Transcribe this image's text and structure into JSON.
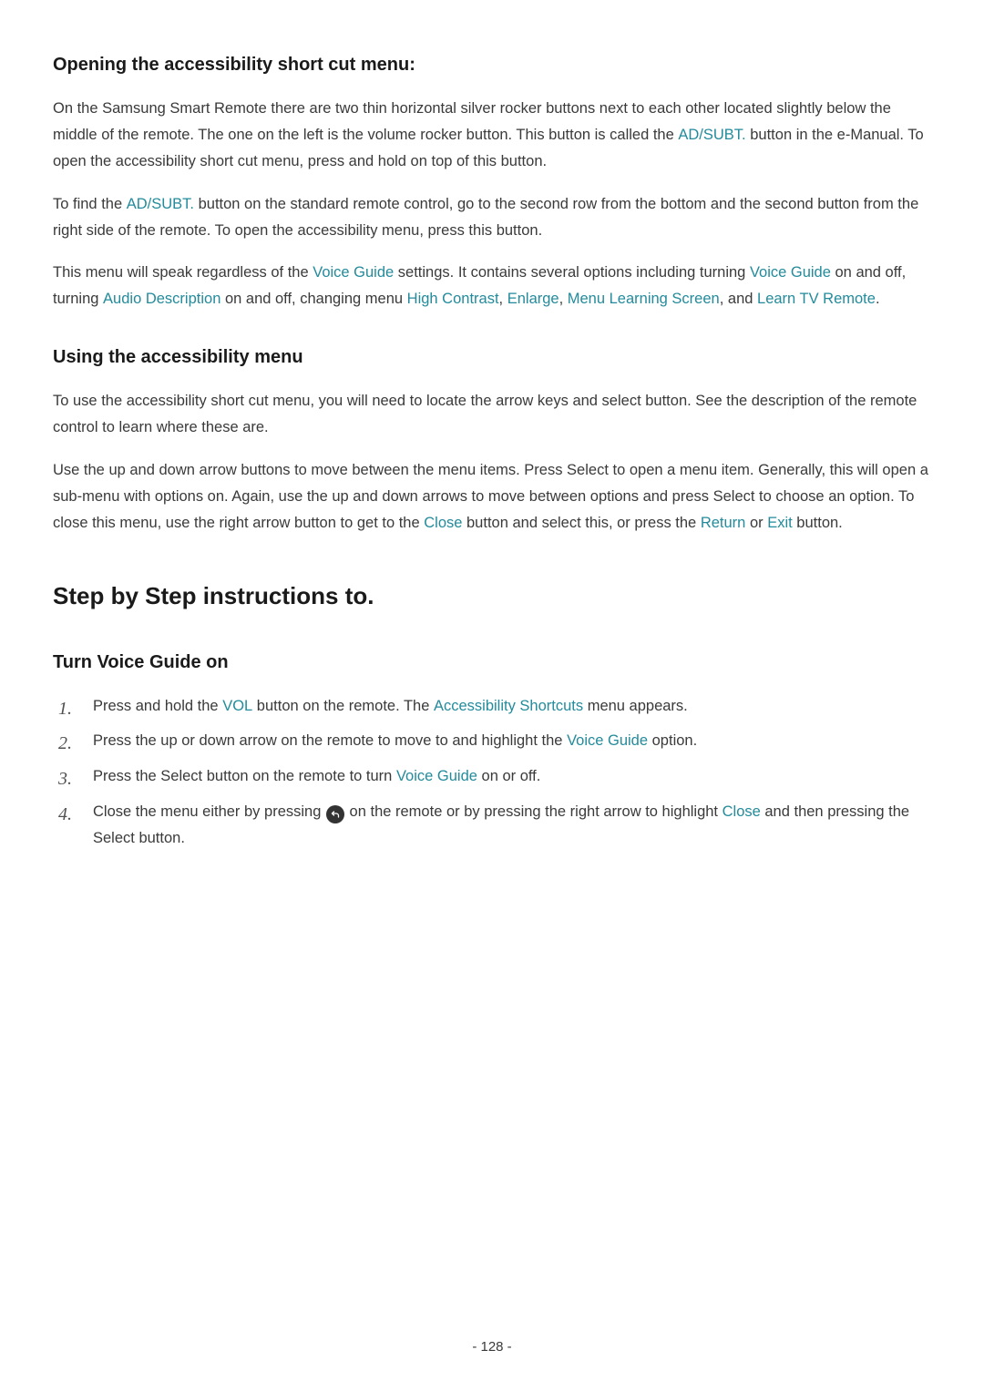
{
  "s1": {
    "heading": "Opening the accessibility short cut menu:",
    "p1a": "On the Samsung Smart Remote there are two thin horizontal silver rocker buttons next to each other located slightly below the middle of the remote. The one on the left is the volume rocker button. This button is called the ",
    "p1_term1": "AD/SUBT.",
    "p1b": " button in the e-Manual. To open the accessibility short cut menu, press and hold on top of this button.",
    "p2a": "To find the ",
    "p2_term1": "AD/SUBT.",
    "p2b": " button on the standard remote control, go to the second row from the bottom and the second button from the right side of the remote. To open the accessibility menu, press this button.",
    "p3a": "This menu will speak regardless of the ",
    "p3_t1": "Voice Guide",
    "p3b": " settings. It contains several options including turning ",
    "p3_t2": "Voice Guide",
    "p3c": " on and off, turning ",
    "p3_t3": "Audio Description",
    "p3d": " on and off, changing menu ",
    "p3_t4": "High Contrast",
    "p3e": ", ",
    "p3_t5": "Enlarge",
    "p3f": ", ",
    "p3_t6": "Menu Learning Screen",
    "p3g": ", and ",
    "p3_t7": "Learn TV Remote",
    "p3h": "."
  },
  "s2": {
    "heading": "Using the accessibility menu",
    "p1": "To use the accessibility short cut menu, you will need to locate the arrow keys and select button. See the description of the remote control to learn where these are.",
    "p2a": "Use the up and down arrow buttons to move between the menu items. Press Select to open a menu item. Generally, this will open a sub-menu with options on. Again, use the up and down arrows to move between options and press Select to choose an option. To close this menu, use the right arrow button to get to the ",
    "p2_t1": "Close",
    "p2b": " button and select this, or press the ",
    "p2_t2": "Return",
    "p2c": " or ",
    "p2_t3": "Exit",
    "p2d": " button."
  },
  "s3": {
    "heading": "Step by Step instructions to.",
    "sub": "Turn Voice Guide on",
    "li1a": "Press and hold the ",
    "li1_t1": "VOL",
    "li1b": " button on the remote. The ",
    "li1_t2": "Accessibility Shortcuts",
    "li1c": " menu appears.",
    "li2a": "Press the up or down arrow on the remote to move to and highlight the ",
    "li2_t1": "Voice Guide",
    "li2b": " option.",
    "li3a": "Press the Select button on the remote to turn ",
    "li3_t1": "Voice Guide",
    "li3b": " on or off.",
    "li4a": "Close the menu either by pressing ",
    "li4b": " on the remote or by pressing the right arrow to highlight ",
    "li4_t1": "Close",
    "li4c": " and then pressing the Select button."
  },
  "page": "- 128 -"
}
